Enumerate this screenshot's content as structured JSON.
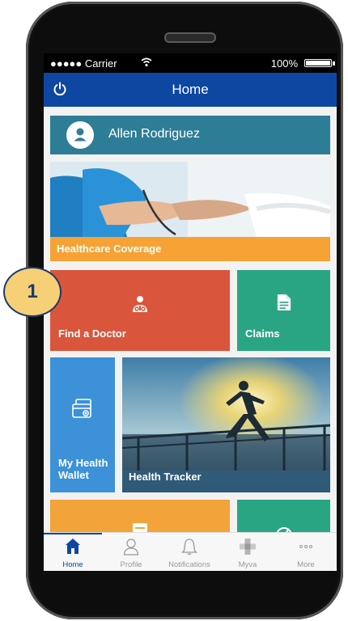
{
  "status_bar": {
    "carrier": "●●●●● Carrier",
    "battery": "100%"
  },
  "nav": {
    "title": "Home"
  },
  "profile": {
    "name": "Allen Rodriguez"
  },
  "tiles": {
    "coverage": "Healthcare Coverage",
    "doctor": "Find a Doctor",
    "claims": "Claims",
    "wallet_line1": "My Health",
    "wallet_line2": "Wallet",
    "tracker": "Health Tracker"
  },
  "tabs": [
    {
      "label": "Home",
      "icon": "home-icon",
      "active": true
    },
    {
      "label": "Profile",
      "icon": "profile-icon"
    },
    {
      "label": "Notifications",
      "icon": "bell-icon"
    },
    {
      "label": "Myva",
      "icon": "myva-icon"
    },
    {
      "label": "More",
      "icon": "more-icon"
    }
  ],
  "step_badge": "1",
  "colors": {
    "nav": "#0d47a1",
    "profile_tile": "#2e7d97",
    "coverage_bar": "#f7a234",
    "doctor_tile": "#d9553b",
    "claims_tile": "#2aa584",
    "wallet_tile": "#3c91d8",
    "badge": "#f6cf76"
  }
}
